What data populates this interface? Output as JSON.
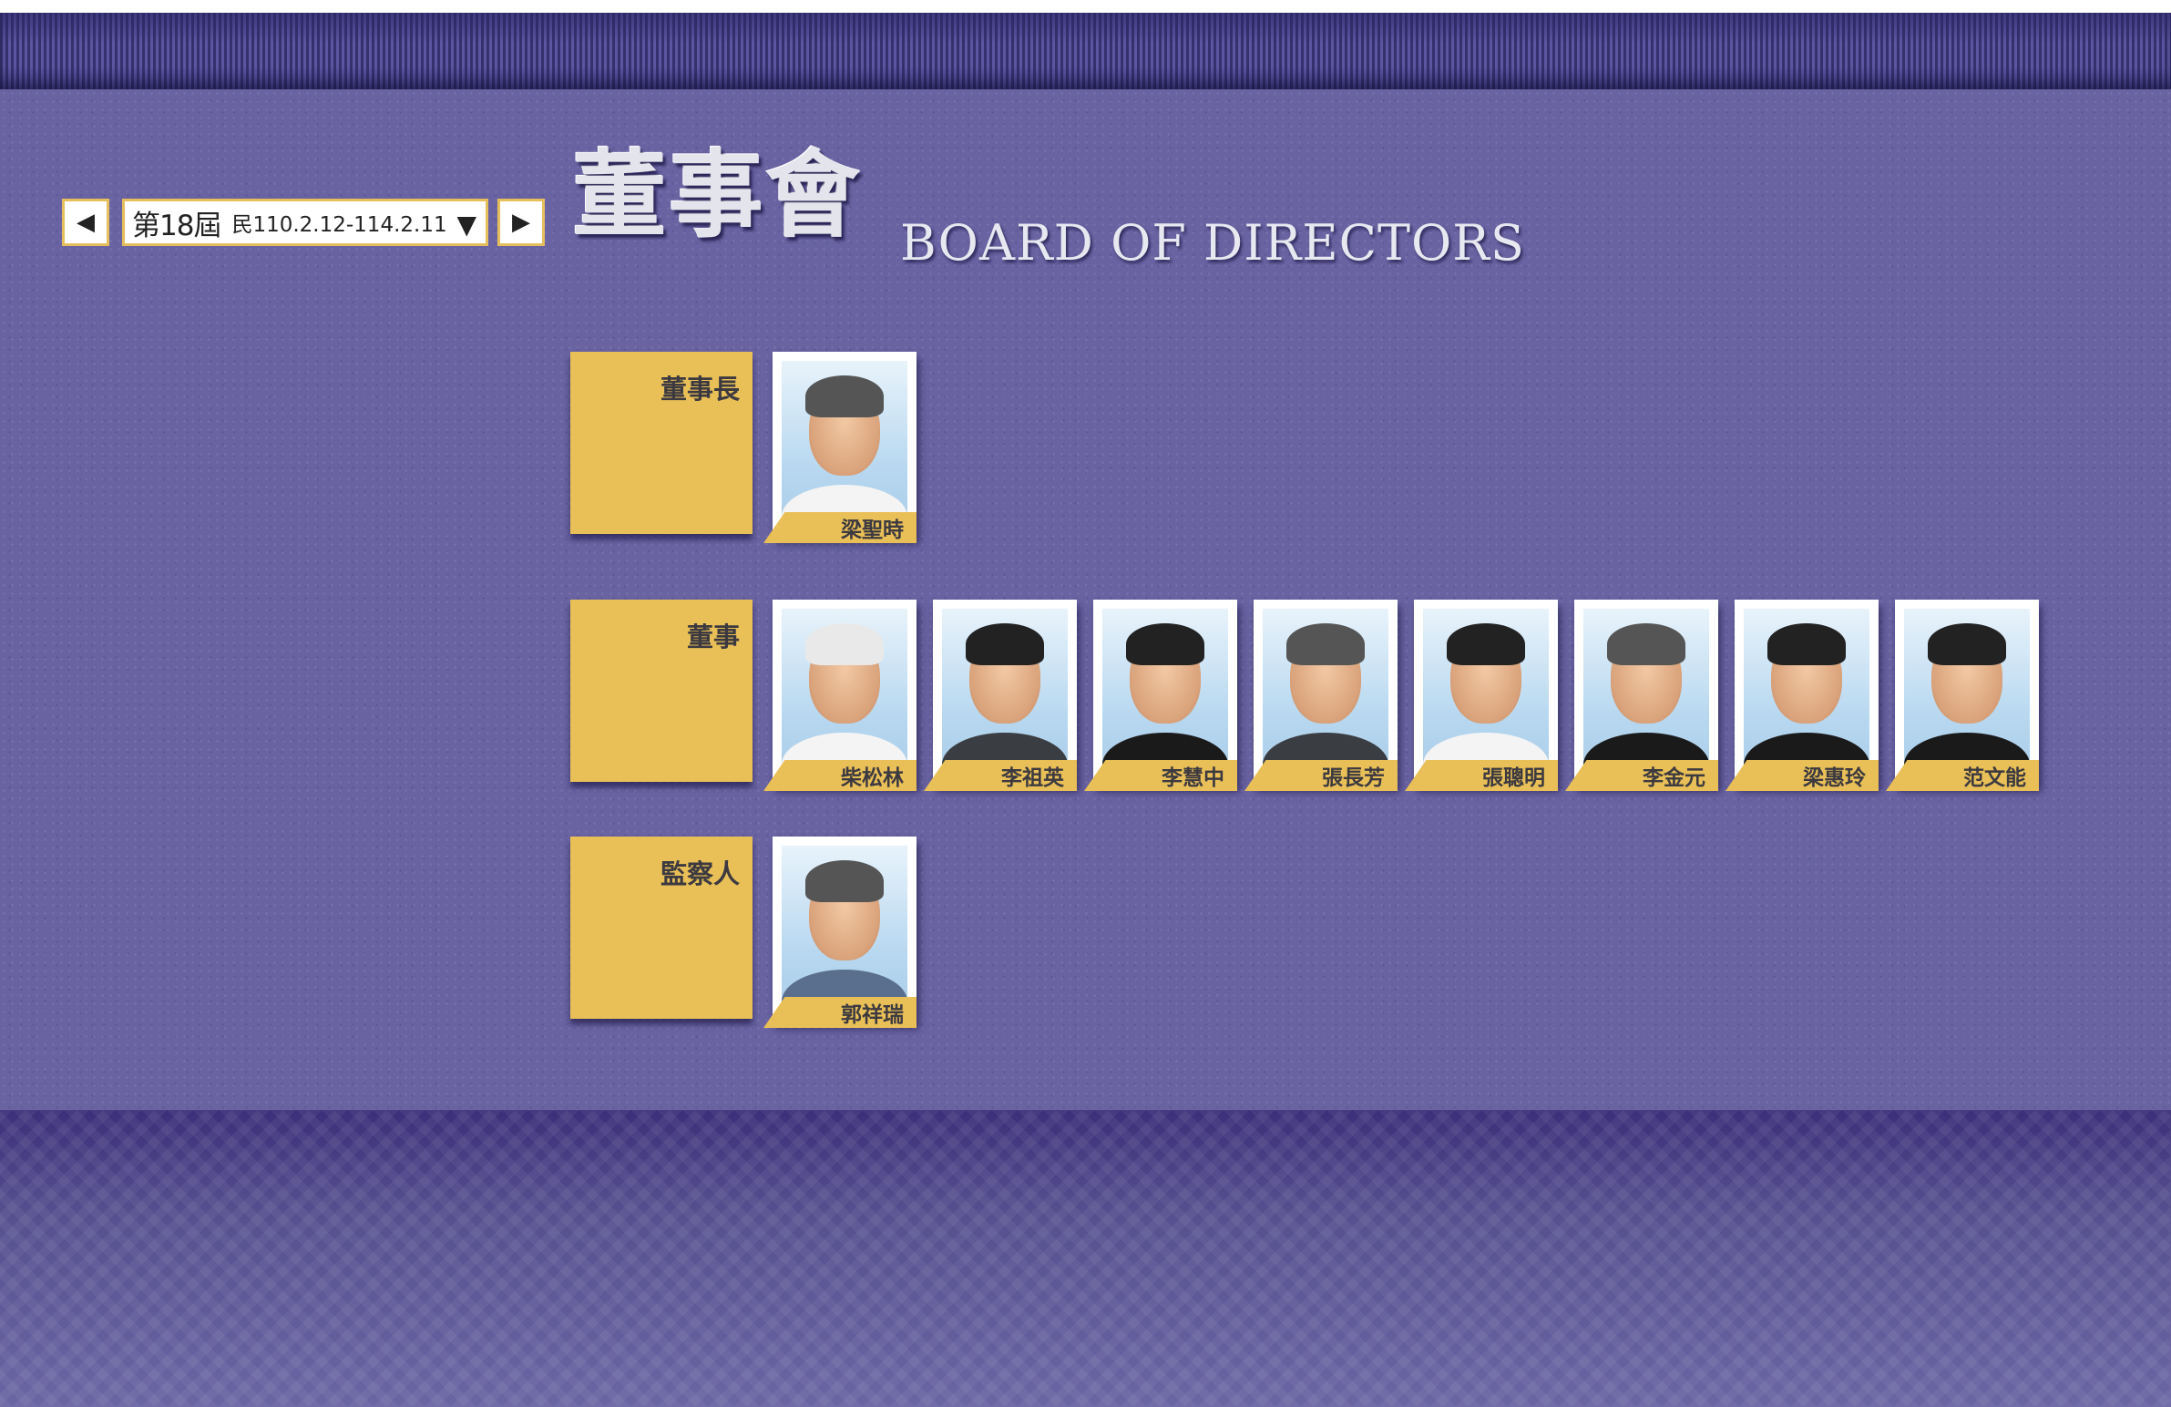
{
  "nav": {
    "prev_icon": "◀",
    "next_icon": "▶",
    "term_label": "第18屆",
    "term_dates": "民110.2.12-114.2.11",
    "dropdown_icon": "▼"
  },
  "title": {
    "zh": "董事會",
    "en": "BOARD OF DIRECTORS"
  },
  "sections": [
    {
      "role": "董事長",
      "members": [
        "梁聖時"
      ]
    },
    {
      "role": "董事",
      "members": [
        "柴松林",
        "李祖英",
        "李慧中",
        "張長芳",
        "張聰明",
        "李金元",
        "梁惠玲",
        "范文能"
      ]
    },
    {
      "role": "監察人",
      "members": [
        "郭祥瑞"
      ]
    }
  ],
  "colors": {
    "background": "#6963a2",
    "accent": "#e9bf57",
    "bottom": "#3c2f7a"
  }
}
